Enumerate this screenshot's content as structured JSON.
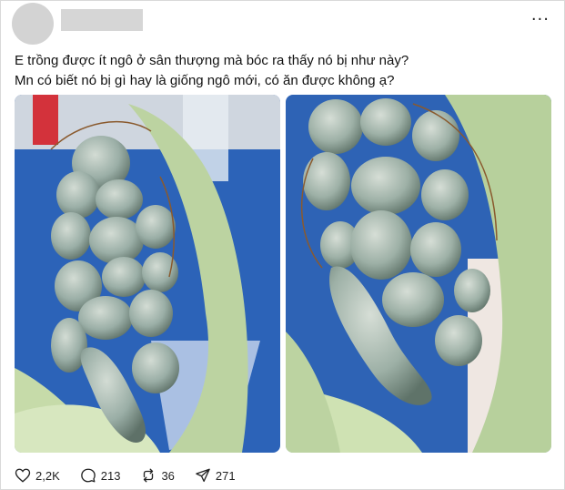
{
  "post": {
    "more_label": "···",
    "text_lines": [
      "E trồng được ít ngô ở sân thượng mà bóc ra thấy nó bị như này?",
      "Mn có biết nó bị gì hay là giống ngô mới, có ăn được không ạ?"
    ],
    "images": [
      {
        "icon": "corn-smut-photo-1"
      },
      {
        "icon": "corn-smut-photo-2"
      }
    ]
  },
  "actions": {
    "likes": "2,2K",
    "comments": "213",
    "reposts": "36",
    "shares": "271"
  }
}
